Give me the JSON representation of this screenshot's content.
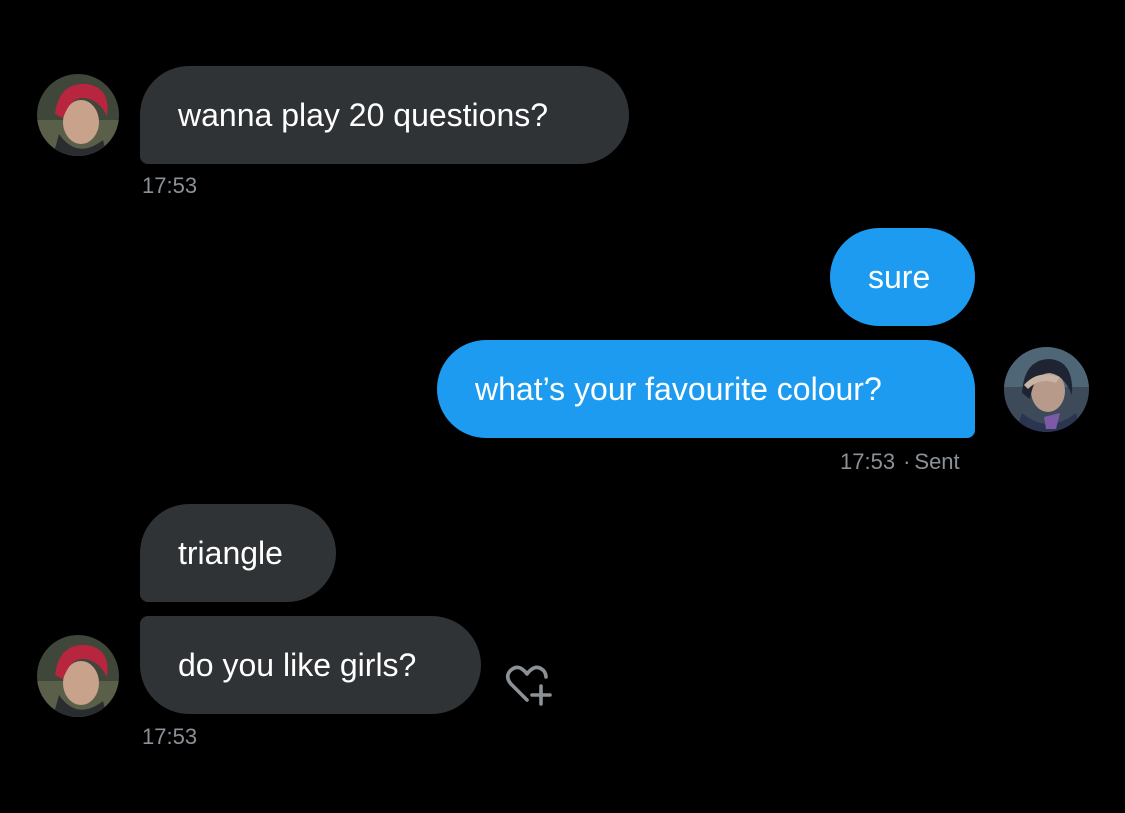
{
  "conversation": {
    "messages": [
      {
        "sender": "them",
        "text": "wanna play 20 questions?",
        "time": "17:53"
      },
      {
        "sender": "me",
        "text": "sure"
      },
      {
        "sender": "me",
        "text": "what’s your favourite colour?",
        "time": "17:53",
        "status": "Sent"
      },
      {
        "sender": "them",
        "text": "triangle"
      },
      {
        "sender": "them",
        "text": "do you like girls?",
        "time": "17:53"
      }
    ]
  },
  "icons": {
    "reaction": "heart-plus-icon",
    "their_avatar": "avatar-red-hair",
    "my_avatar": "avatar-dark-hair"
  },
  "colors": {
    "background": "#000000",
    "incoming_bubble": "#2f3336",
    "outgoing_bubble": "#1d9bf0",
    "meta_text": "#8b9196"
  }
}
